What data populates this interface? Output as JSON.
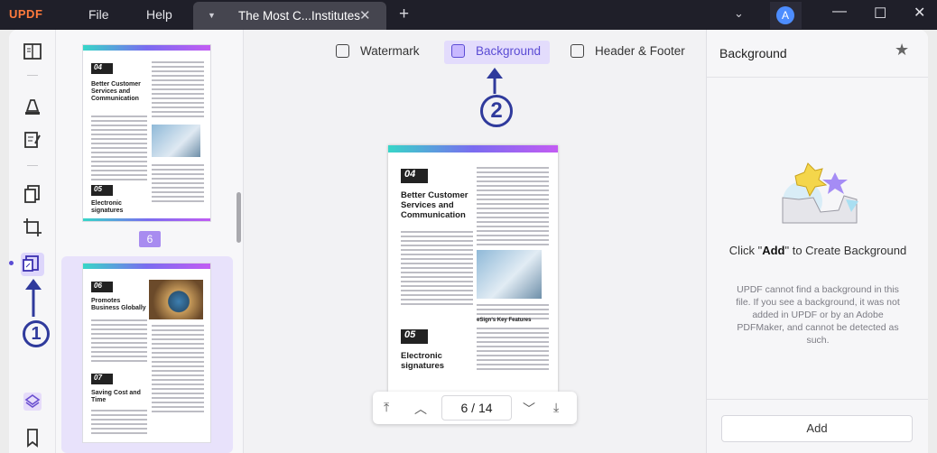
{
  "app": {
    "logo": "UPDF"
  },
  "menu": {
    "file": "File",
    "help": "Help"
  },
  "tab": {
    "title": "The Most C...Institutes"
  },
  "user": {
    "avatar_letter": "A"
  },
  "toolbar": {
    "tabs": [
      {
        "label": "Watermark",
        "icon": "watermark-icon"
      },
      {
        "label": "Background",
        "icon": "background-icon",
        "active": true
      },
      {
        "label": "Header & Footer",
        "icon": "header-footer-icon"
      }
    ]
  },
  "thumbnails": {
    "page6": {
      "s1_num": "04",
      "s1_title": "Better Customer Services and Communication",
      "s2_num": "05",
      "s2_title": "Electronic signatures",
      "label": "6"
    },
    "page7": {
      "s1_num": "06",
      "s1_title": "Promotes Business Globally",
      "s2_num": "07",
      "s2_title": "Saving Cost and Time"
    }
  },
  "preview": {
    "s1_num": "04",
    "s1_title": "Better Customer Services and Communication",
    "s2_num": "05",
    "s2_title": "Electronic signatures",
    "subhead": "eSign's Key Features"
  },
  "pagination": {
    "current": "6",
    "separator": "/",
    "total": "14"
  },
  "annotations": {
    "one": "1",
    "two": "2"
  },
  "panel": {
    "title": "Background",
    "prompt_pre": "Click \"",
    "prompt_add": "Add",
    "prompt_post": "\" to Create Background",
    "description": "UPDF cannot find a background in this file. If you see a background, it was not added in UPDF or by an Adobe PDFMaker, and cannot be detected as such.",
    "add_button": "Add"
  },
  "colors": {
    "accent": "#5b4cd4",
    "annotation": "#2f3a9c",
    "titlebar": "#1f1f29"
  }
}
